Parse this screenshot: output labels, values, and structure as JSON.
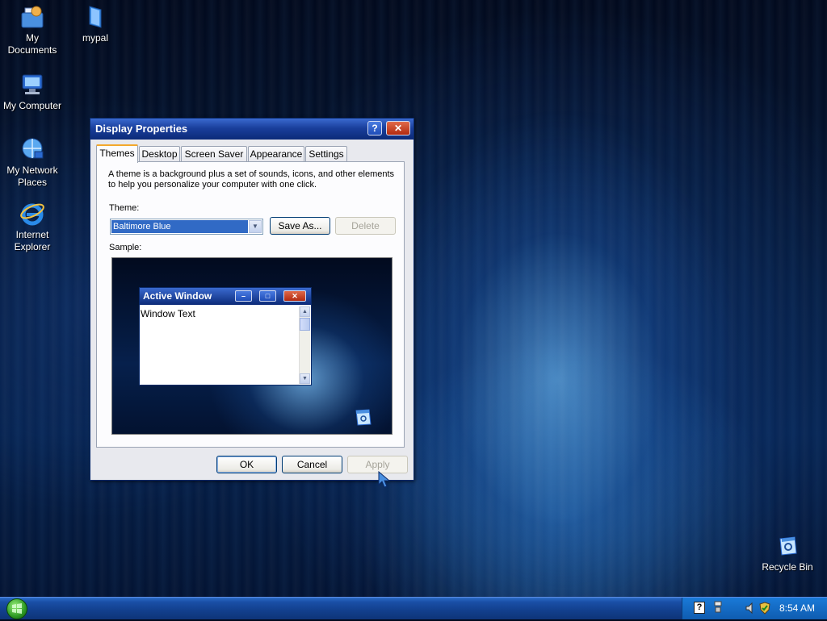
{
  "desktop": {
    "icons": [
      {
        "label": "My Documents",
        "icon": "my-documents-icon"
      },
      {
        "label": "mypal",
        "icon": "folder-icon"
      },
      {
        "label": "My Computer",
        "icon": "my-computer-icon"
      },
      {
        "label": "My Network Places",
        "icon": "network-icon"
      },
      {
        "label": "Internet Explorer",
        "icon": "internet-explorer-icon"
      },
      {
        "label": "Recycle Bin",
        "icon": "recycle-bin-icon"
      }
    ]
  },
  "dialog": {
    "title": "Display Properties",
    "help_label": "?",
    "close_label": "✕",
    "tabs": [
      {
        "label": "Themes",
        "active": true
      },
      {
        "label": "Desktop"
      },
      {
        "label": "Screen Saver"
      },
      {
        "label": "Appearance"
      },
      {
        "label": "Settings"
      }
    ],
    "description": "A theme is a background plus a set of sounds, icons, and other elements to help you personalize your computer with one click.",
    "theme_label": "Theme:",
    "theme_value": "Baltimore Blue",
    "save_as_label": "Save As...",
    "delete_label": "Delete",
    "sample_label": "Sample:",
    "sample": {
      "window_title": "Active Window",
      "window_text": "Window Text"
    },
    "ok_label": "OK",
    "cancel_label": "Cancel",
    "apply_label": "Apply"
  },
  "taskbar": {
    "clock": "8:54 AM"
  },
  "colors": {
    "title_bar": "#1a3f9c",
    "selection": "#316ac5",
    "taskbar": "#123f8c",
    "tab_highlight": "#f3a82c"
  }
}
